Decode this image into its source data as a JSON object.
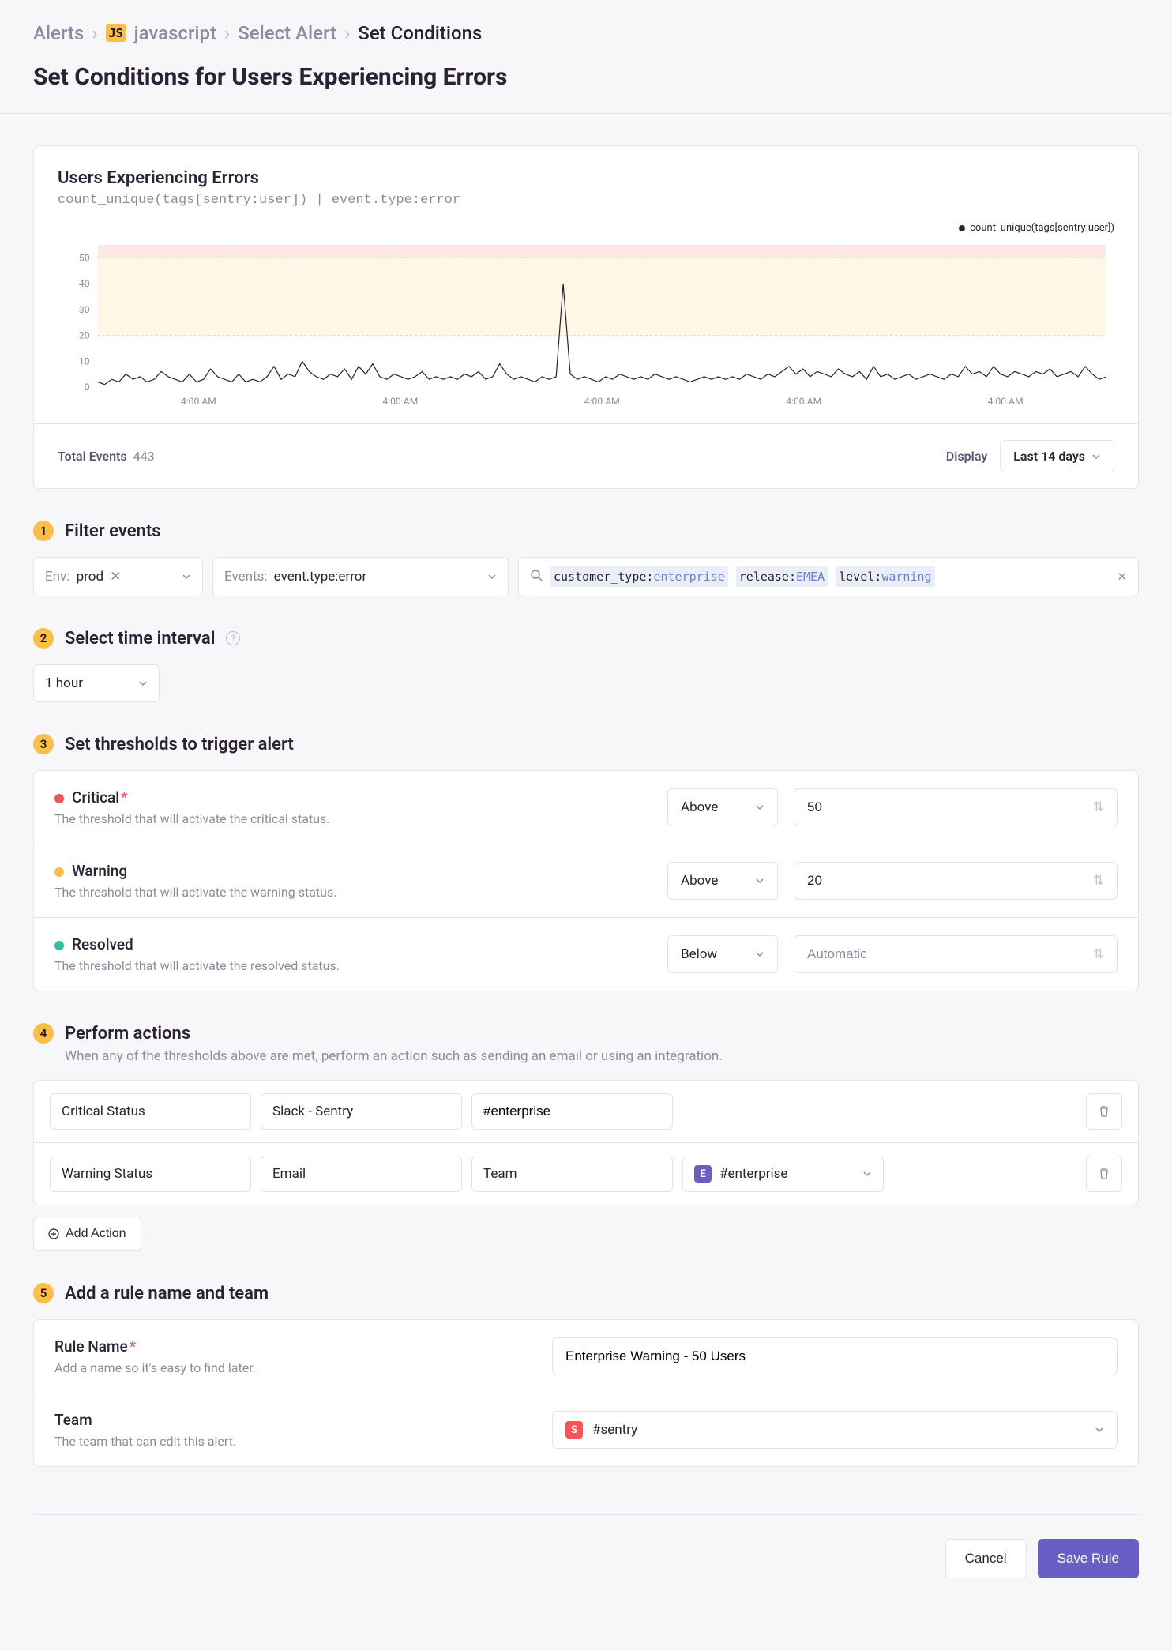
{
  "breadcrumb": {
    "alerts": "Alerts",
    "js_badge": "JS",
    "project": "javascript",
    "select_alert": "Select Alert",
    "set_conditions": "Set Conditions"
  },
  "title": "Set Conditions for Users Experiencing Errors",
  "chart": {
    "title": "Users Experiencing Errors",
    "subtitle": "count_unique(tags[sentry:user]) | event.type:error",
    "legend": "count_unique(tags[sentry:user])",
    "y_ticks": [
      "50",
      "40",
      "30",
      "20",
      "10",
      "0"
    ],
    "x_ticks": [
      "4:00 AM",
      "4:00 AM",
      "4:00 AM",
      "4:00 AM",
      "4:00 AM"
    ],
    "total_events_label": "Total Events",
    "total_events_value": "443",
    "display_label": "Display",
    "display_value": "Last 14 days"
  },
  "chart_data": {
    "type": "line",
    "title": "Users Experiencing Errors",
    "ylabel": "count_unique(tags[sentry:user])",
    "xlabel": "",
    "ylim": [
      0,
      55
    ],
    "thresholds": {
      "critical": 50,
      "warning": 20
    },
    "x_categories": [
      "4:00 AM",
      "4:00 AM",
      "4:00 AM",
      "4:00 AM",
      "4:00 AM"
    ],
    "series": [
      {
        "name": "count_unique(tags[sentry:user])",
        "values": [
          2,
          1,
          3,
          2,
          5,
          3,
          4,
          2,
          3,
          6,
          4,
          3,
          2,
          5,
          2,
          3,
          7,
          4,
          3,
          2,
          5,
          2,
          3,
          2,
          4,
          8,
          3,
          5,
          4,
          10,
          6,
          4,
          3,
          5,
          4,
          7,
          3,
          8,
          5,
          9,
          4,
          3,
          5,
          4,
          3,
          4,
          6,
          3,
          4,
          3,
          4,
          3,
          5,
          4,
          6,
          3,
          4,
          9,
          5,
          3,
          4,
          3,
          2,
          4,
          3,
          4,
          40,
          5,
          3,
          4,
          3,
          2,
          4,
          3,
          5,
          4,
          3,
          4,
          3,
          5,
          4,
          3,
          4,
          3,
          2,
          3,
          4,
          3,
          4,
          3,
          4,
          3,
          5,
          4,
          3,
          5,
          4,
          6,
          8,
          5,
          7,
          4,
          6,
          5,
          4,
          7,
          5,
          4,
          6,
          3,
          8,
          4,
          5,
          3,
          4,
          5,
          3,
          4,
          5,
          4,
          3,
          5,
          4,
          8,
          5,
          6,
          4,
          8,
          5,
          4,
          6,
          5,
          4,
          6,
          5,
          7,
          4,
          5,
          6,
          4,
          8,
          5,
          3,
          4
        ]
      }
    ]
  },
  "steps": {
    "s1": "Filter events",
    "s2": "Select time interval",
    "s3": "Set thresholds to trigger alert",
    "s4": "Perform actions",
    "s4_sub": "When any of the thresholds above are met, perform an action such as sending an email or using an integration.",
    "s5": "Add a rule name and team"
  },
  "filter": {
    "env_label": "Env:",
    "env_value": "prod",
    "events_label": "Events:",
    "events_value": "event.type:error",
    "tokens": [
      {
        "key": "customer_type:",
        "val": "enterprise"
      },
      {
        "key": "release:",
        "val": "EMEA"
      },
      {
        "key": "level:",
        "val": "warning"
      }
    ]
  },
  "interval": {
    "value": "1 hour"
  },
  "thresholds": {
    "critical": {
      "name": "Critical",
      "desc": "The threshold that will activate the critical status.",
      "dir": "Above",
      "val": "50"
    },
    "warning": {
      "name": "Warning",
      "desc": "The threshold that will activate the warning status.",
      "dir": "Above",
      "val": "20"
    },
    "resolved": {
      "name": "Resolved",
      "desc": "The threshold that will activate the resolved status.",
      "dir": "Below",
      "placeholder": "Automatic"
    }
  },
  "actions": {
    "row1": {
      "status": "Critical Status",
      "channel": "Slack - Sentry",
      "target": "#enterprise"
    },
    "row2": {
      "status": "Warning Status",
      "channel": "Email",
      "scope": "Team",
      "team_badge": "E",
      "team_name": "#enterprise"
    },
    "add_label": "Add Action"
  },
  "rule": {
    "name_label": "Rule Name",
    "name_desc": "Add a name so it's easy to find later.",
    "name_value": "Enterprise Warning - 50 Users",
    "team_label": "Team",
    "team_desc": "The team that can edit this alert.",
    "team_badge": "S",
    "team_value": "#sentry"
  },
  "footer": {
    "cancel": "Cancel",
    "save": "Save Rule"
  }
}
